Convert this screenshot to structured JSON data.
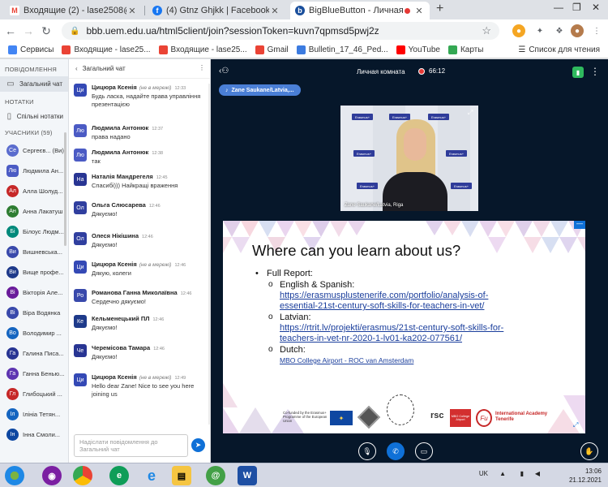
{
  "browser": {
    "tabs": [
      {
        "title": "Входящие (2) - lase2508@gmail",
        "favicon": "gmail-icon",
        "active": false
      },
      {
        "title": "(4) Gtnz Ghjkk | Facebook",
        "favicon": "facebook-icon",
        "active": false
      },
      {
        "title": "BigBlueButton - Личная ком",
        "favicon": "bbb-icon",
        "active": true
      }
    ],
    "new_tab": "+",
    "address": "bbb.uem.edu.ua/html5client/join?sessionToken=kuvn7qpmsd5pwj2z",
    "bookmarks": [
      {
        "label": "Сервисы",
        "icon": "apps-icon",
        "color": "#4285f4"
      },
      {
        "label": "Входящие - lase25...",
        "icon": "gmail-icon",
        "color": "#ea4335"
      },
      {
        "label": "Входящие - lase25...",
        "icon": "gmail-icon",
        "color": "#ea4335"
      },
      {
        "label": "Gmail",
        "icon": "gmail-icon",
        "color": "#ea4335"
      },
      {
        "label": "Bulletin_17_46_Ped...",
        "icon": "doc-icon",
        "color": "#3c7be0"
      },
      {
        "label": "YouTube",
        "icon": "youtube-icon",
        "color": "#ff0000"
      },
      {
        "label": "Карты",
        "icon": "maps-icon",
        "color": "#34a853"
      }
    ],
    "reading_list": "Список для чтения"
  },
  "sidebar": {
    "messages_header": "ПОВІДОМЛЕННЯ",
    "public_chat": "Загальний чат",
    "notes_header": "НОТАТКИ",
    "shared_notes": "Спільні нотатки",
    "participants_header": "УЧАСНИКИ (59)",
    "users": [
      {
        "initials": "Се",
        "name": "Сергеєв... (Ви)",
        "color": "#5b6dce",
        "round": true
      },
      {
        "initials": "Лю",
        "name": "Людмила Ан...",
        "color": "#4b5bc4",
        "round": false
      },
      {
        "initials": "Ал",
        "name": "Алла Шолуд...",
        "color": "#c62828",
        "round": true
      },
      {
        "initials": "Ан",
        "name": "Анна Лакатуш",
        "color": "#2e7d32",
        "round": true
      },
      {
        "initials": "Бі",
        "name": "Білоус Людм...",
        "color": "#00897b",
        "round": true
      },
      {
        "initials": "Ви",
        "name": "Вишневська...",
        "color": "#3949ab",
        "round": true
      },
      {
        "initials": "Ви",
        "name": "Вище профе...",
        "color": "#1e3a8a",
        "round": true
      },
      {
        "initials": "Ві",
        "name": "Вікторія Але...",
        "color": "#6a1b9a",
        "round": true
      },
      {
        "initials": "Ві",
        "name": "Віра Водянка",
        "color": "#3949ab",
        "round": true
      },
      {
        "initials": "Во",
        "name": "Володимир ...",
        "color": "#1565c0",
        "round": true
      },
      {
        "initials": "Га",
        "name": "Галина Писа...",
        "color": "#283593",
        "round": true
      },
      {
        "initials": "Га",
        "name": "Ганна Бенью...",
        "color": "#5e35b1",
        "round": true
      },
      {
        "initials": "Гл",
        "name": "Глибоцький ...",
        "color": "#c62828",
        "round": true
      },
      {
        "initials": "Іл",
        "name": "Ілініа Тетян...",
        "color": "#1565c0",
        "round": true
      },
      {
        "initials": "Ін",
        "name": "Інна Смоли...",
        "color": "#0d47a1",
        "round": true
      }
    ]
  },
  "chat": {
    "title": "Загальний чат",
    "messages": [
      {
        "initials": "Ци",
        "name": "Цицюра Ксенія",
        "sub": "(не в мережі)",
        "time": "12:33",
        "text": "Будь ласка, надайте права управління презентацією",
        "color": "#3449b5"
      },
      {
        "initials": "Лю",
        "name": "Людмила Антонюк",
        "sub": "",
        "time": "12:37",
        "text": "права надано",
        "color": "#4b5bc4"
      },
      {
        "initials": "Лю",
        "name": "Людмила Антонюк",
        "sub": "",
        "time": "12:38",
        "text": "так",
        "color": "#4b5bc4"
      },
      {
        "initials": "На",
        "name": "Наталія Мандрегеля",
        "sub": "",
        "time": "12:45",
        "text": "Спасибі))) Найкращі враження",
        "color": "#283593"
      },
      {
        "initials": "Ол",
        "name": "Ольга Слюсарева",
        "sub": "",
        "time": "12:46",
        "text": "Дякуємо!",
        "color": "#303f9f"
      },
      {
        "initials": "Ол",
        "name": "Олеся Нікішина",
        "sub": "",
        "time": "12:46",
        "text": "Дякуємо!",
        "color": "#303f9f"
      },
      {
        "initials": "Ци",
        "name": "Цицюра Ксенія",
        "sub": "(не в мережі)",
        "time": "12:46",
        "text": "Дякую, колеги",
        "color": "#3449b5"
      },
      {
        "initials": "Ро",
        "name": "Романова Ганна Миколаївна",
        "sub": "",
        "time": "12:46",
        "text": "Сердечно дякуємо!",
        "color": "#3949ab"
      },
      {
        "initials": "Ке",
        "name": "Кельменецький ПЛ",
        "sub": "",
        "time": "12:46",
        "text": "Дякуємо!",
        "color": "#1e3a8a"
      },
      {
        "initials": "Че",
        "name": "Черемісова Тамара",
        "sub": "",
        "time": "12:46",
        "text": "Дякуємо!",
        "color": "#283593"
      },
      {
        "initials": "Ци",
        "name": "Цицюра Ксенія",
        "sub": "(не в мережі)",
        "time": "12:49",
        "text": "Hello dear Zane! Nice to see you here joining us",
        "color": "#3449b5"
      }
    ],
    "input_placeholder": "Надіслати повідомлення до Загальний чат"
  },
  "meeting": {
    "room_title": "Личная комната",
    "timer": "66:12",
    "talker": "Zane Saukane/Latvia,...",
    "webcam_label": "Zane Saukane/Latvia, Riga",
    "banner_text": "Erasmus+"
  },
  "slide": {
    "title": "Where can you learn about us?",
    "items": [
      {
        "level": 1,
        "text": "Full Report:"
      },
      {
        "level": 2,
        "text": "English & Spanish:"
      },
      {
        "level": 3,
        "text": "https://erasmusplustenerife.com/portfolio/analysis-of-"
      },
      {
        "level": 3,
        "text": "essential-21st-century-soft-skills-for-teachers-in-vet/"
      },
      {
        "level": 2,
        "text": "Latvian:"
      },
      {
        "level": 3,
        "text": "https://rtrit.lv/projekti/erasmus/21st-century-soft-skills-for-"
      },
      {
        "level": 3,
        "text": "teachers-in-vet-nr-2020-1-lv01-ka202-077561/"
      },
      {
        "level": 2,
        "text": "Dutch:"
      },
      {
        "level": 4,
        "text": "MBO College Airport - ROC van Amsterdam"
      }
    ],
    "logo_cofunded": "Co-funded by the Erasmus+ Programme of the European Union",
    "logo_ia": "International Academy Tenerife",
    "logo_rsc": "rsc",
    "logo_mbo": "MBO College Airport"
  },
  "taskbar": {
    "lang": "UK",
    "time": "13:06",
    "date": "21.12.2021"
  }
}
